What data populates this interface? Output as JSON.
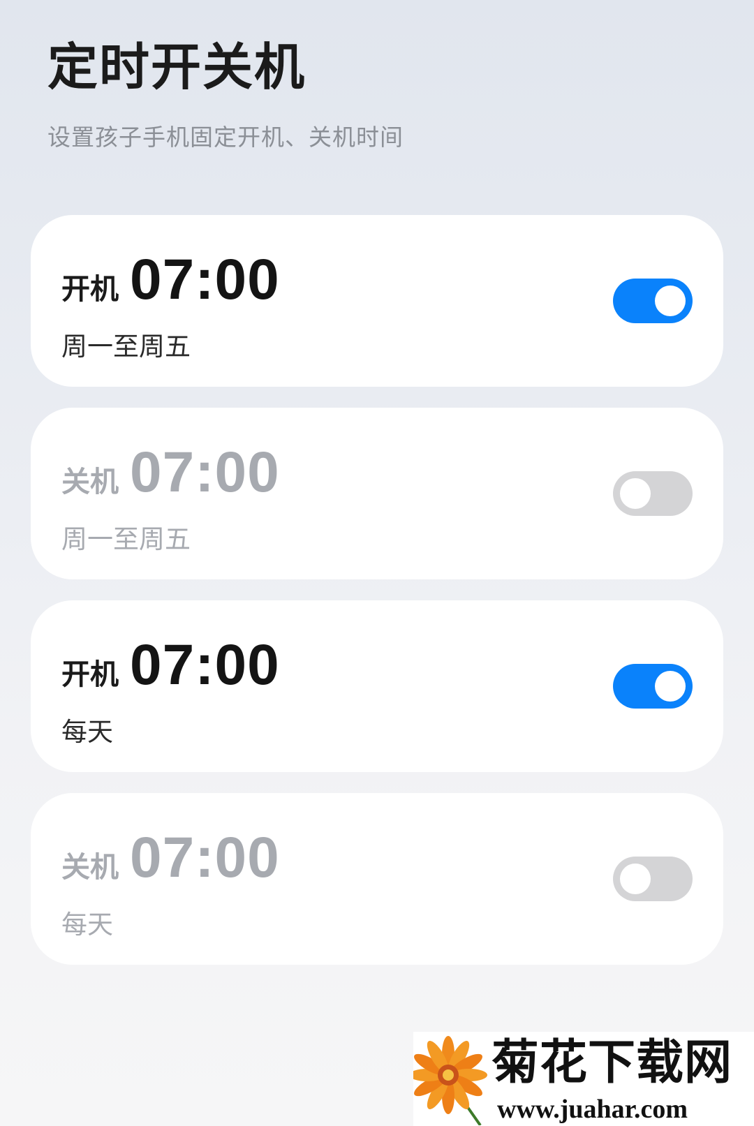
{
  "header": {
    "title": "定时开关机",
    "subtitle": "设置孩子手机固定开机、关机时间"
  },
  "schedules": [
    {
      "action": "开机",
      "time": "07:00",
      "days": "周一至周五",
      "enabled": true
    },
    {
      "action": "关机",
      "time": "07:00",
      "days": "周一至周五",
      "enabled": false
    },
    {
      "action": "开机",
      "time": "07:00",
      "days": "每天",
      "enabled": true
    },
    {
      "action": "关机",
      "time": "07:00",
      "days": "每天",
      "enabled": false
    }
  ],
  "colors": {
    "accent": "#0a82fb",
    "toggle_off": "#d4d4d6",
    "muted_text": "#a7aab0"
  },
  "watermark": {
    "name": "菊花下载网",
    "url": "www.juahar.com",
    "icon": "chrysanthemum-logo-icon"
  }
}
